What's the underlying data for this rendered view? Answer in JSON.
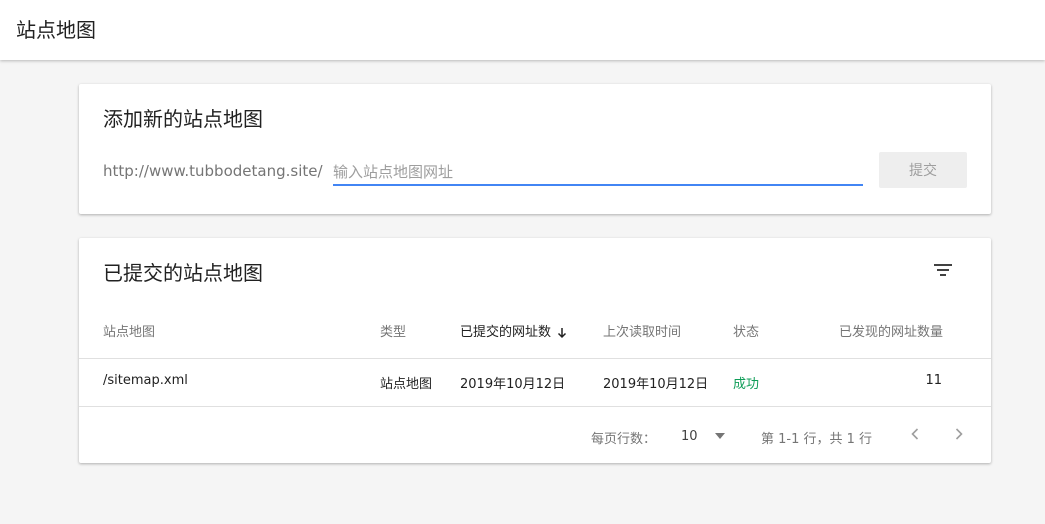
{
  "page": {
    "title": "站点地图"
  },
  "add_card": {
    "title": "添加新的站点地图",
    "url_prefix": "http://www.tubbodetang.site/",
    "input_value": "",
    "input_placeholder": "输入站点地图网址",
    "submit_label": "提交"
  },
  "submitted_card": {
    "title": "已提交的站点地图",
    "columns": {
      "sitemap": "站点地图",
      "type": "类型",
      "submitted": "已提交的网址数",
      "last_read": "上次读取时间",
      "status": "状态",
      "discovered": "已发现的网址数量"
    },
    "rows": [
      {
        "sitemap": "/sitemap.xml",
        "type": "站点地图",
        "submitted": "2019年10月12日",
        "last_read": "2019年10月12日",
        "status": "成功",
        "discovered": "11"
      }
    ],
    "footer": {
      "rows_per_page_label": "每页行数：",
      "rows_per_page_value": "10",
      "range_text": "第 1-1 行，共 1 行"
    }
  },
  "colors": {
    "accent": "#4285f4",
    "success": "#0f9d58"
  }
}
